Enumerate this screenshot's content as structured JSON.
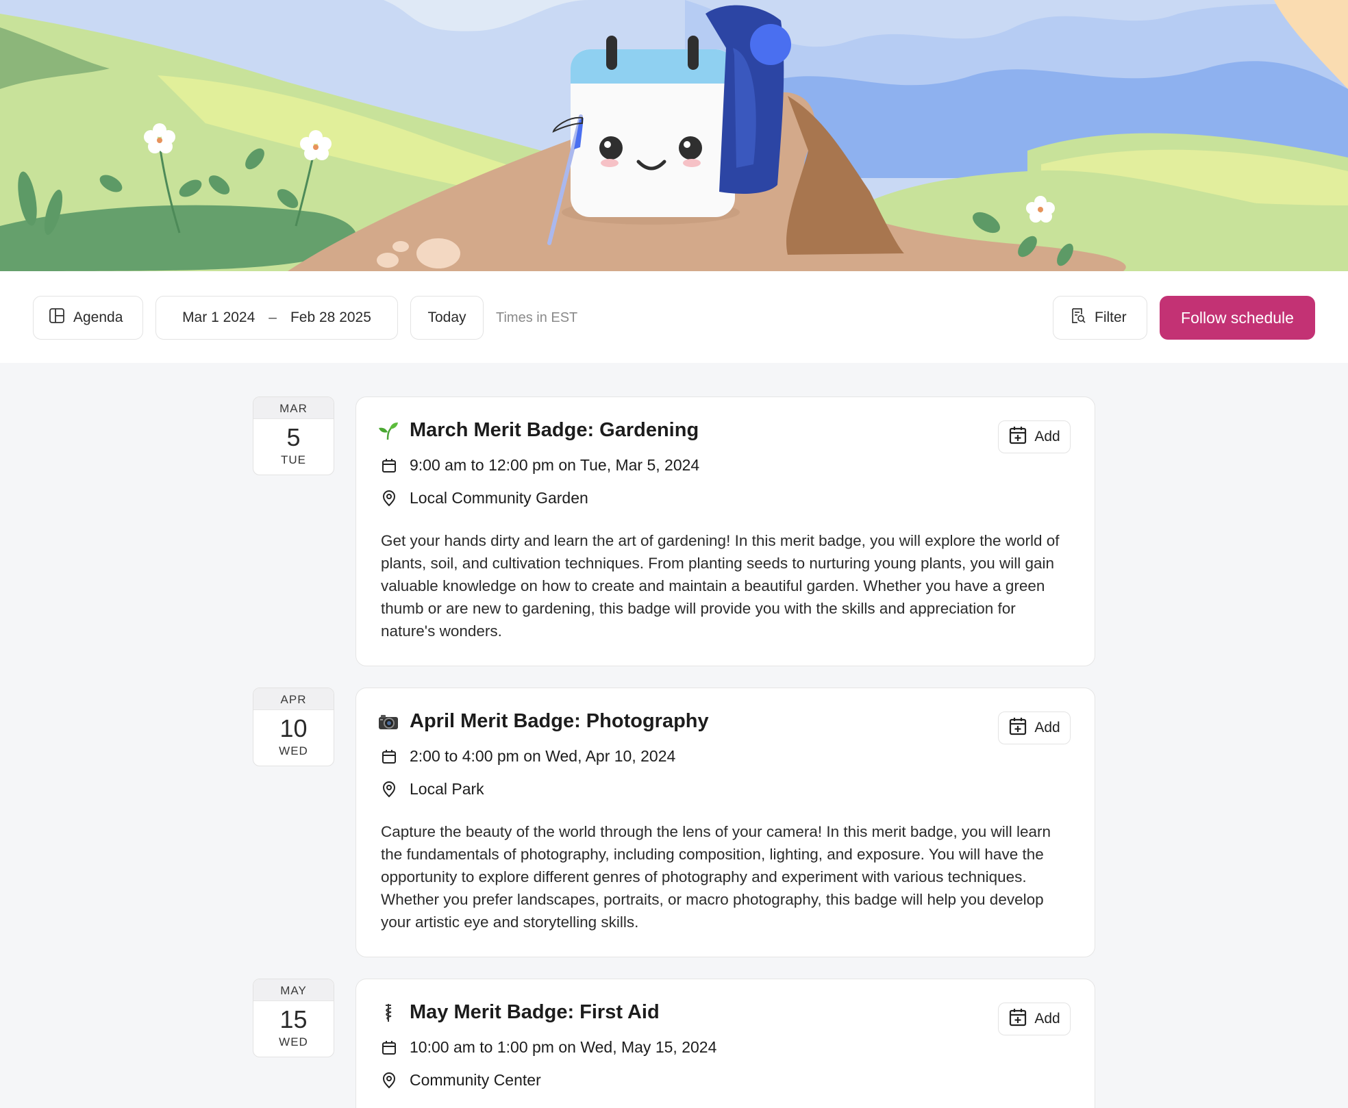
{
  "toolbar": {
    "view_label": "Agenda",
    "range_start": "Mar 1 2024",
    "range_sep": "–",
    "range_end": "Feb 28 2025",
    "today_label": "Today",
    "timezone_label": "Times in EST",
    "filter_label": "Filter",
    "follow_label": "Follow schedule"
  },
  "colors": {
    "accent": "#c33274",
    "page_bg": "#f5f6f8"
  },
  "events": [
    {
      "month": "MAR",
      "day": "5",
      "weekday": "TUE",
      "emoji_icon": "seedling-icon",
      "emoji": "🌱",
      "title": "March Merit Badge: Gardening",
      "time": "9:00 am to 12:00 pm on Tue, Mar 5, 2024",
      "location": "Local Community Garden",
      "description": "Get your hands dirty and learn the art of gardening! In this merit badge, you will explore the world of plants, soil, and cultivation techniques. From planting seeds to nurturing young plants, you will gain valuable knowledge on how to create and maintain a beautiful garden. Whether you have a green thumb or are new to gardening, this badge will provide you with the skills and appreciation for nature's wonders.",
      "add_label": "Add"
    },
    {
      "month": "APR",
      "day": "10",
      "weekday": "WED",
      "emoji_icon": "camera-icon",
      "emoji": "📷",
      "title": "April Merit Badge: Photography",
      "time": "2:00 to 4:00 pm on Wed, Apr 10, 2024",
      "location": "Local Park",
      "description": "Capture the beauty of the world through the lens of your camera! In this merit badge, you will learn the fundamentals of photography, including composition, lighting, and exposure. You will have the opportunity to explore different genres of photography and experiment with various techniques. Whether you prefer landscapes, portraits, or macro photography, this badge will help you develop your artistic eye and storytelling skills.",
      "add_label": "Add"
    },
    {
      "month": "MAY",
      "day": "15",
      "weekday": "WED",
      "emoji_icon": "medical-symbol-icon",
      "emoji": "⚕",
      "title": "May Merit Badge: First Aid",
      "time": "10:00 am to 1:00 pm on Wed, May 15, 2024",
      "location": "Community Center",
      "description": "",
      "add_label": "Add"
    }
  ]
}
